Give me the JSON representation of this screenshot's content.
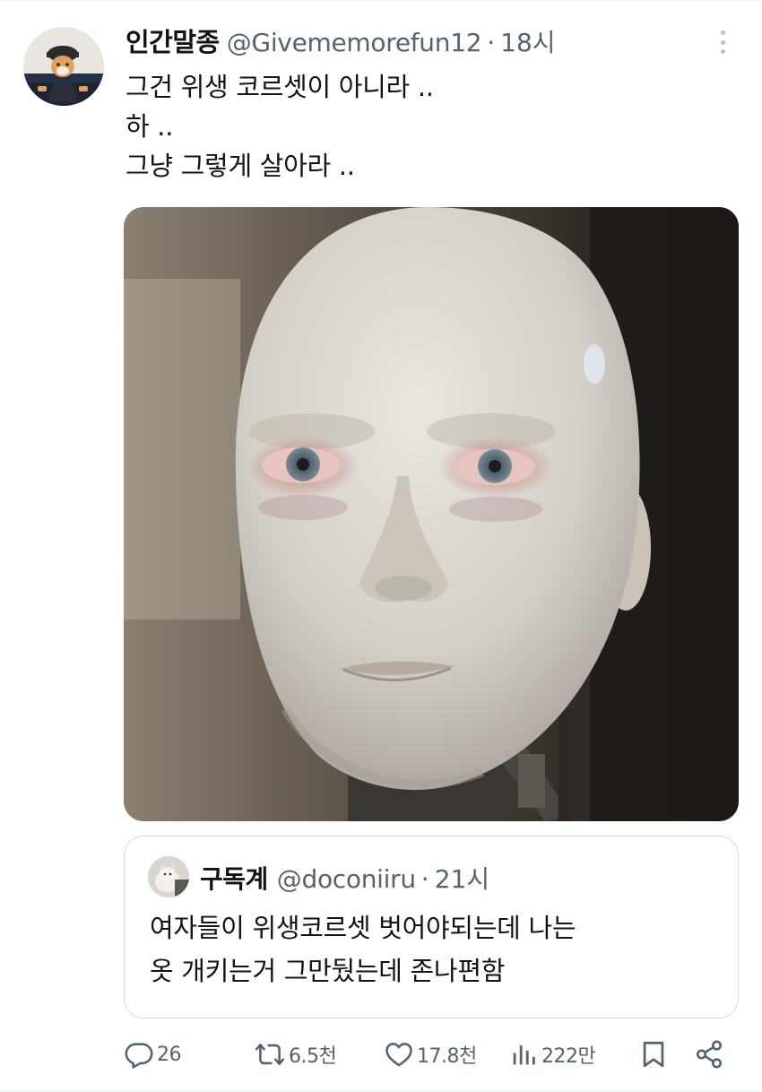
{
  "tweet": {
    "author_name": "인간말종",
    "author_handle": "@Givememorefun12",
    "separator": "·",
    "time": "18시",
    "lines": [
      "그건 위생 코르셋이 아니라 ..",
      "하 ..",
      "그냥 그렇게 살아라 .."
    ]
  },
  "quote": {
    "author_name": "구독계",
    "author_handle": "@doconiiru",
    "separator": "·",
    "time": "21시",
    "lines": [
      "여자들이 위생코르셋 벗어야되는데 나는",
      "옷 개키는거 그만뒀는데 존나편함"
    ]
  },
  "actions": {
    "replies": "26",
    "retweets": "6.5천",
    "likes": "17.8천",
    "views": "222만"
  },
  "icons": {
    "reply": "comment-bubble-icon",
    "retweet": "retweet-icon",
    "like": "heart-icon",
    "views": "bar-chart-icon",
    "bookmark": "bookmark-icon",
    "share": "share-icon",
    "more": "more-vertical-icon"
  },
  "colors": {
    "text": "#0f1419",
    "secondary": "#536471",
    "border": "#cfd9de"
  }
}
